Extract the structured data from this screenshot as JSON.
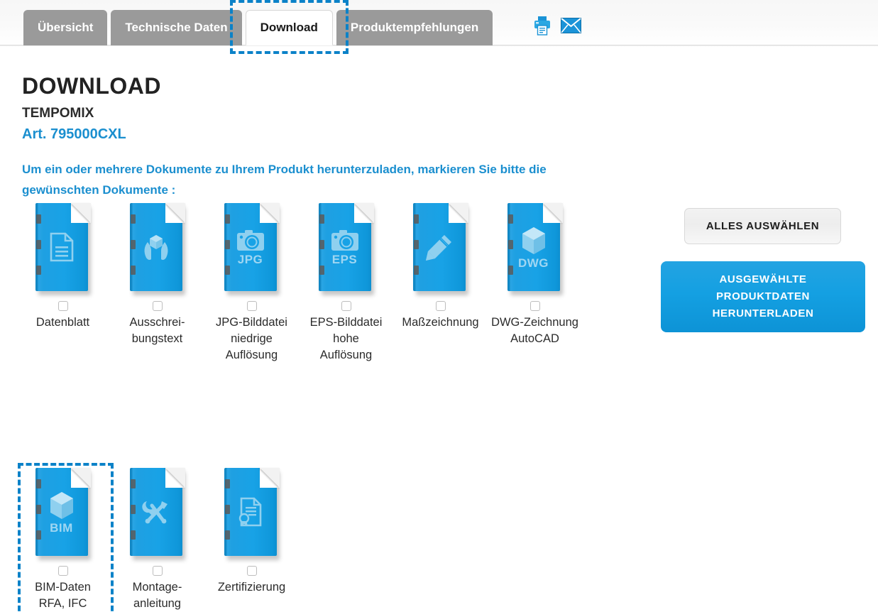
{
  "tabs": [
    {
      "label": "Übersicht",
      "active": false
    },
    {
      "label": "Technische Daten",
      "active": false
    },
    {
      "label": "Download",
      "active": true
    },
    {
      "label": "Produktempfehlungen",
      "active": false
    }
  ],
  "header_icons": [
    {
      "name": "printer-icon",
      "title": "Drucken"
    },
    {
      "name": "envelope-icon",
      "title": "E-Mail"
    }
  ],
  "page": {
    "title": "DOWNLOAD",
    "product_name": "TEMPOMIX",
    "article_number": "Art. 795000CXL",
    "instructions": "Um ein oder mehrere Dokumente zu Ihrem Produkt herunterzuladen, markieren Sie bitte die gewünschten Dokumente :"
  },
  "documents_row1": [
    {
      "label": "Datenblatt",
      "icon": "document-lines-icon",
      "ext": "",
      "checked": false,
      "highlighted": false
    },
    {
      "label": "Ausschrei-\nbungstext",
      "icon": "hands-cube-icon",
      "ext": "",
      "checked": false,
      "highlighted": false
    },
    {
      "label": "JPG-Bilddatei\nniedrige\nAuflösung",
      "icon": "camera-icon",
      "ext": "JPG",
      "checked": false,
      "highlighted": false
    },
    {
      "label": "EPS-Bilddatei\nhohe\nAuflösung",
      "icon": "camera-icon",
      "ext": "EPS",
      "checked": false,
      "highlighted": false
    },
    {
      "label": "Maßzeichnung",
      "icon": "pencil-icon",
      "ext": "",
      "checked": false,
      "highlighted": false
    },
    {
      "label": "DWG-Zeichnung\nAutoCAD",
      "icon": "cube-icon",
      "ext": "DWG",
      "checked": false,
      "highlighted": false
    }
  ],
  "documents_row2": [
    {
      "label": "BIM-Daten\nRFA, IFC",
      "icon": "cube-icon",
      "ext": "BIM",
      "checked": false,
      "highlighted": true
    },
    {
      "label": "Montage-\nanleitung",
      "icon": "tools-icon",
      "ext": "",
      "checked": false,
      "highlighted": false
    },
    {
      "label": "Zertifizierung",
      "icon": "certificate-icon",
      "ext": "",
      "checked": false,
      "highlighted": false
    }
  ],
  "actions": {
    "select_all": "ALLES AUSWÄHLEN",
    "download": "AUSGEWÄHLTE\nPRODUKTDATEN\nHERUNTERLADEN"
  },
  "colors": {
    "brand_blue": "#1b8fcf",
    "icon_blue": "#16a0e3",
    "tab_gray": "#9a9a9a",
    "focus_dash": "#0b82c8",
    "text_dark": "#2b2b2b"
  }
}
